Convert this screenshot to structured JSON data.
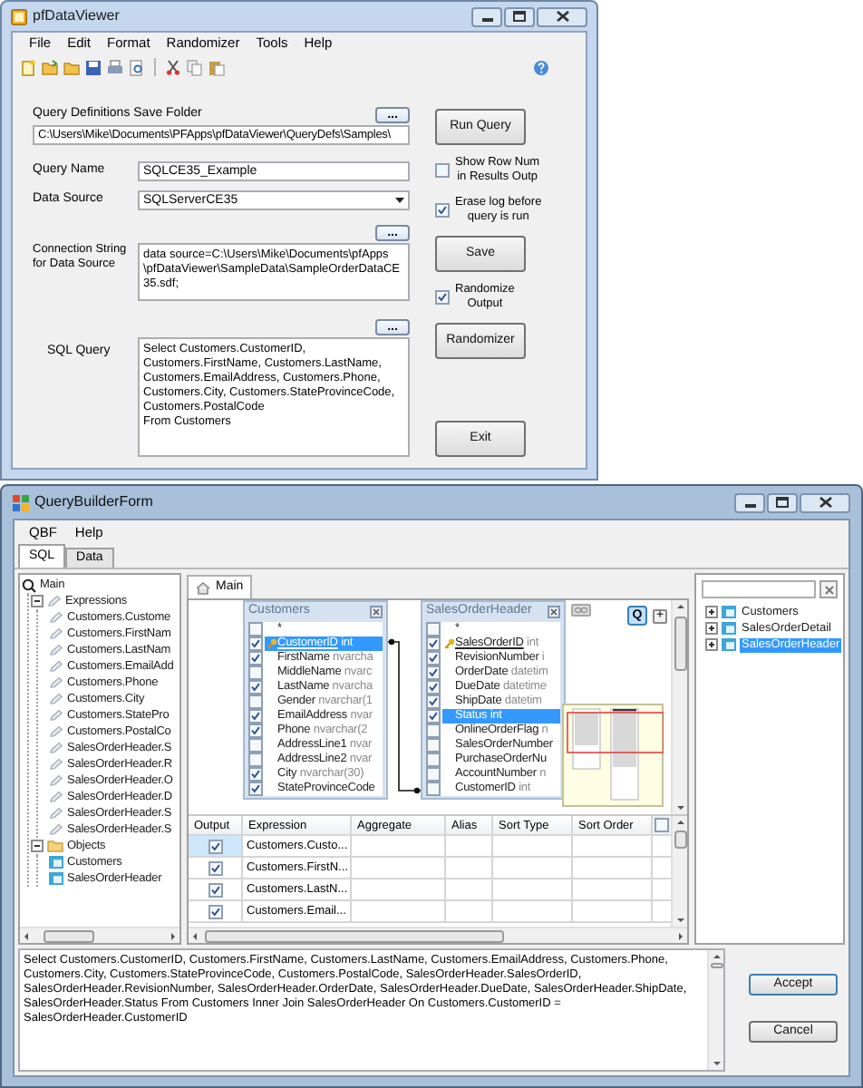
{
  "query_window": {
    "title": "pfDataViewer",
    "menu": [
      "File",
      "Edit",
      "Format",
      "Randomizer",
      "Tools",
      "Help"
    ],
    "save_folder": {
      "label": "Query Definitions Save Folder",
      "browse": "...",
      "value": "C:\\Users\\Mike\\Documents\\PFApps\\pfDataViewer\\QueryDefs\\Samples\\"
    },
    "query_name": {
      "label": "Query Name",
      "value": "SQLCE35_Example"
    },
    "data_source": {
      "label": "Data Source",
      "value": "SQLServerCE35"
    },
    "connection_string": {
      "label_lines": [
        "Connection String",
        "for Data Source"
      ],
      "browse": "...",
      "value": "data source=C:\\Users\\Mike\\Documents\\pfApps\n\\pfDataViewer\\SampleData\\SampleOrderDataCE35.sdf;"
    },
    "sql_query": {
      "label": "SQL Query",
      "browse": "...",
      "value": "Select Customers.CustomerID, Customers.FirstName, Customers.LastName, Customers.EmailAddress, Customers.Phone, Customers.City, Customers.StateProvinceCode, Customers.PostalCode\nFrom Customers"
    },
    "side_controls": [
      {
        "kind": "button",
        "label_lines": [
          "Run Query"
        ]
      },
      {
        "kind": "checkbox",
        "label_lines": [
          "Show Row Num",
          "in Results Outp"
        ],
        "checked": false
      },
      {
        "kind": "checkbox",
        "label_lines": [
          "Erase log before",
          "query is run"
        ],
        "checked": true
      },
      {
        "kind": "button",
        "label_lines": [
          "Save"
        ]
      },
      {
        "kind": "checkbox",
        "label_lines": [
          "Randomize",
          "Output"
        ],
        "checked": true
      },
      {
        "kind": "button",
        "label_lines": [
          "Randomizer"
        ]
      },
      {
        "kind": "button",
        "label_lines": [
          "Exit"
        ]
      }
    ]
  },
  "builder_window": {
    "title": "QueryBuilderForm",
    "menu": [
      "QBF",
      "Help"
    ],
    "tabs": [
      {
        "label": "SQL",
        "selected": true
      },
      {
        "label": "Data",
        "selected": false
      }
    ],
    "outline": {
      "label": "Main",
      "kind": "query",
      "children": [
        {
          "label": "Expressions",
          "kind": "expressions",
          "expanded": true,
          "children": [
            {
              "label": "Customers.Custome",
              "kind": "expression"
            },
            {
              "label": "Customers.FirstNam",
              "kind": "expression"
            },
            {
              "label": "Customers.LastNam",
              "kind": "expression"
            },
            {
              "label": "Customers.EmailAdd",
              "kind": "expression"
            },
            {
              "label": "Customers.Phone",
              "kind": "expression"
            },
            {
              "label": "Customers.City",
              "kind": "expression"
            },
            {
              "label": "Customers.StatePro",
              "kind": "expression"
            },
            {
              "label": "Customers.PostalCo",
              "kind": "expression"
            },
            {
              "label": "SalesOrderHeader.S",
              "kind": "expression"
            },
            {
              "label": "SalesOrderHeader.R",
              "kind": "expression"
            },
            {
              "label": "SalesOrderHeader.O",
              "kind": "expression"
            },
            {
              "label": "SalesOrderHeader.D",
              "kind": "expression"
            },
            {
              "label": "SalesOrderHeader.S",
              "kind": "expression"
            },
            {
              "label": "SalesOrderHeader.S",
              "kind": "expression"
            }
          ]
        },
        {
          "label": "Objects",
          "kind": "folder",
          "expanded": true,
          "children": [
            {
              "label": "Customers",
              "kind": "table"
            },
            {
              "label": "SalesOrderHeader",
              "kind": "table"
            }
          ]
        }
      ]
    },
    "designer": {
      "tabs": [
        {
          "label": "Main",
          "selected": true
        }
      ],
      "query_button": "Q",
      "add_button": "+",
      "tables": [
        {
          "name": "Customers",
          "fields": [
            {
              "name": "*",
              "checked": false,
              "key": false,
              "selected": false
            },
            {
              "name": "CustomerID",
              "type": "int",
              "checked": true,
              "key": true,
              "selected": true
            },
            {
              "name": "FirstName",
              "type": "nvarcha",
              "checked": true,
              "key": false,
              "selected": false
            },
            {
              "name": "MiddleName",
              "type": "nvarc",
              "checked": false,
              "key": false,
              "selected": false
            },
            {
              "name": "LastName",
              "type": "nvarcha",
              "checked": true,
              "key": false,
              "selected": false
            },
            {
              "name": "Gender",
              "type": "nvarchar(1",
              "checked": false,
              "key": false,
              "selected": false
            },
            {
              "name": "EmailAddress",
              "type": "nvar",
              "checked": true,
              "key": false,
              "selected": false
            },
            {
              "name": "Phone",
              "type": "nvarchar(2",
              "checked": true,
              "key": false,
              "selected": false
            },
            {
              "name": "AddressLine1",
              "type": "nvar",
              "checked": false,
              "key": false,
              "selected": false
            },
            {
              "name": "AddressLine2",
              "type": "nvar",
              "checked": false,
              "key": false,
              "selected": false
            },
            {
              "name": "City",
              "type": "nvarchar(30)",
              "checked": true,
              "key": false,
              "selected": false
            },
            {
              "name": "StateProvinceCode",
              "checked": true,
              "key": false,
              "selected": false
            }
          ]
        },
        {
          "name": "SalesOrderHeader",
          "fields": [
            {
              "name": "*",
              "checked": false,
              "key": false,
              "selected": false
            },
            {
              "name": "SalesOrderID",
              "type": "int",
              "checked": true,
              "key": true,
              "selected": false
            },
            {
              "name": "RevisionNumber",
              "type": "i",
              "checked": true,
              "key": false,
              "selected": false
            },
            {
              "name": "OrderDate",
              "type": "datetim",
              "checked": true,
              "key": false,
              "selected": false
            },
            {
              "name": "DueDate",
              "type": "datetime",
              "checked": true,
              "key": false,
              "selected": false
            },
            {
              "name": "ShipDate",
              "type": "datetim",
              "checked": true,
              "key": false,
              "selected": false
            },
            {
              "name": "Status",
              "type": "int",
              "checked": true,
              "key": false,
              "selected": true
            },
            {
              "name": "OnlineOrderFlag",
              "type": "n",
              "checked": false,
              "key": false,
              "selected": false
            },
            {
              "name": "SalesOrderNumber",
              "checked": false,
              "key": false,
              "selected": false
            },
            {
              "name": "PurchaseOrderNu",
              "checked": false,
              "key": false,
              "selected": false
            },
            {
              "name": "AccountNumber",
              "type": "n",
              "checked": false,
              "key": false,
              "selected": false
            },
            {
              "name": "CustomerID",
              "type": "int",
              "checked": false,
              "key": false,
              "selected": false
            }
          ]
        }
      ],
      "grid": {
        "columns": [
          "Output",
          "Expression",
          "Aggregate",
          "Alias",
          "Sort Type",
          "Sort Order"
        ],
        "select_all_checked": false,
        "rows": [
          {
            "output": true,
            "expression": "Customers.Custo...",
            "selected": true
          },
          {
            "output": true,
            "expression": "Customers.FirstN...",
            "selected": false
          },
          {
            "output": true,
            "expression": "Customers.LastN...",
            "selected": false
          },
          {
            "output": true,
            "expression": "Customers.Email...",
            "selected": false
          }
        ]
      }
    },
    "object_tree": [
      {
        "label": "Customers",
        "expanded": false,
        "selected": false
      },
      {
        "label": "SalesOrderDetail",
        "expanded": false,
        "selected": false
      },
      {
        "label": "SalesOrderHeader",
        "expanded": false,
        "selected": true
      }
    ],
    "sql_text": "Select Customers.CustomerID, Customers.FirstName, Customers.LastName, Customers.EmailAddress, Customers.Phone, Customers.City, Customers.StateProvinceCode, Customers.PostalCode, SalesOrderHeader.SalesOrderID, SalesOrderHeader.RevisionNumber, SalesOrderHeader.OrderDate, SalesOrderHeader.DueDate, SalesOrderHeader.ShipDate, SalesOrderHeader.Status From Customers Inner Join SalesOrderHeader On Customers.CustomerID = SalesOrderHeader.CustomerID",
    "buttons": [
      {
        "label": "Accept",
        "default": true
      },
      {
        "label": "Cancel",
        "default": false
      }
    ]
  }
}
